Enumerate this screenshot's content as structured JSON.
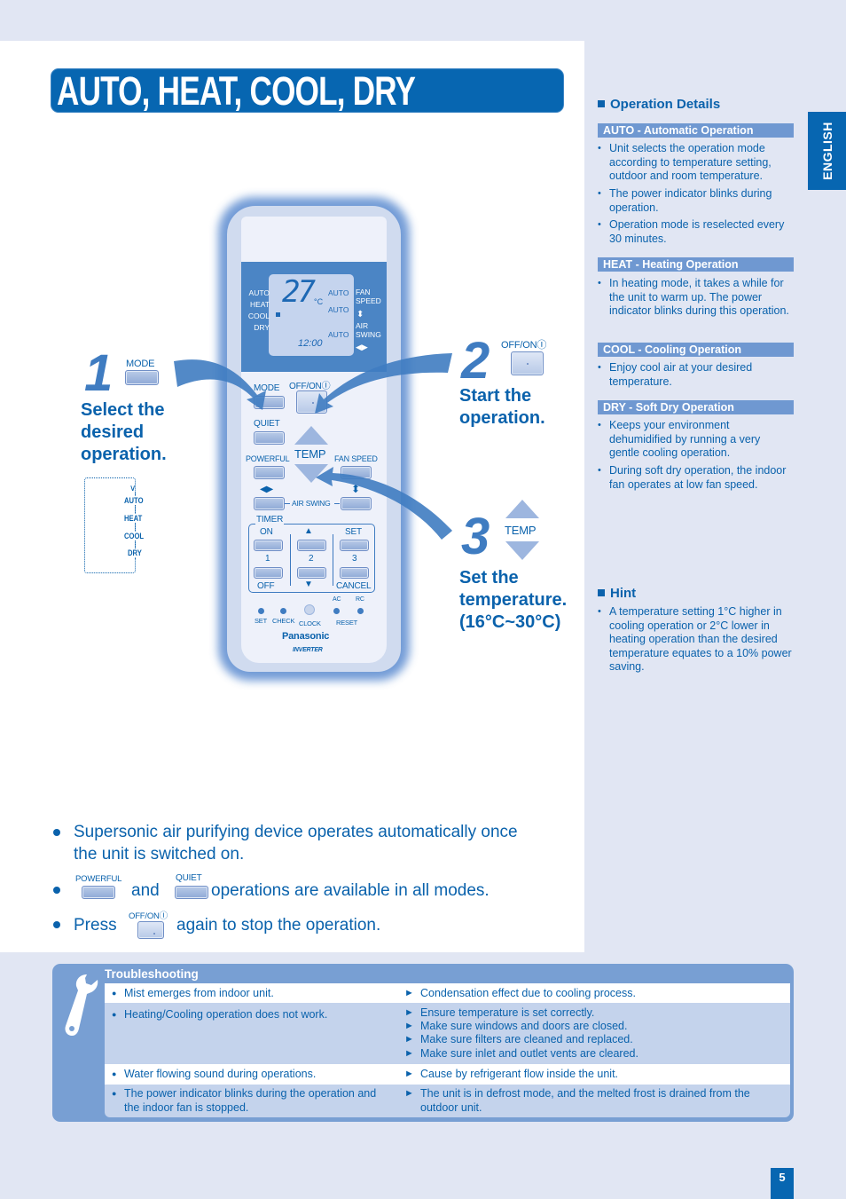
{
  "title": "AUTO, HEAT, COOL, DRY",
  "language_tab": "ENGLISH",
  "page_number": "5",
  "steps": [
    {
      "number": "1",
      "button_label": "MODE",
      "text_lines": [
        "Select the",
        "desired",
        "operation."
      ]
    },
    {
      "number": "2",
      "button_label": "OFF/ONⒾ",
      "text_lines": [
        "Start the",
        "operation."
      ]
    },
    {
      "number": "3",
      "button_label": "TEMP",
      "text_lines": [
        "Set the",
        "temperature.",
        "(16°C~30°C)"
      ]
    }
  ],
  "mode_cycle": [
    "AUTO",
    "HEAT",
    "COOL",
    "DRY"
  ],
  "remote": {
    "display": {
      "modes": [
        "AUTO",
        "HEAT",
        "COOL",
        "DRY"
      ],
      "temperature": "27",
      "unit": "°C",
      "clock": "12:00",
      "auto_labels": [
        "AUTO",
        "AUTO",
        "AUTO"
      ],
      "fan_speed_label": [
        "FAN",
        "SPEED"
      ],
      "air_swing_label": [
        "AIR",
        "SWING"
      ]
    },
    "buttons": {
      "mode": "MODE",
      "off_on": "OFF/ONⒾ",
      "quiet": "QUIET",
      "powerful": "POWERFUL",
      "temp": "TEMP",
      "fan_speed": "FAN SPEED",
      "air_swing": "AIR SWING",
      "timer": "TIMER",
      "on": "ON",
      "off": "OFF",
      "set": "SET",
      "cancel": "CANCEL",
      "num1": "1",
      "num2": "2",
      "num3": "3",
      "set_small": "SET",
      "check": "CHECK",
      "clock": "CLOCK",
      "ac": "AC",
      "rc": "RC",
      "reset": "RESET"
    },
    "brand": "Panasonic",
    "sub_brand": "INVERTER"
  },
  "notes": {
    "line1a": "Supersonic air purifying device operates automatically once",
    "line1b": "the unit is switched on.",
    "powerful_label": "POWERFUL",
    "and": "and",
    "quiet_label": "QUIET",
    "line2_tail": "operations are available in all modes.",
    "press": "Press",
    "offon_label": "OFF/ONⒾ",
    "line3_tail": "again to stop the operation."
  },
  "operation_details": {
    "heading": "Operation Details",
    "sections": [
      {
        "title": "AUTO - Automatic Operation",
        "items": [
          "Unit selects the operation mode according to temperature setting, outdoor and room temperature.",
          "The power indicator blinks during operation.",
          "Operation mode is reselected every 30 minutes."
        ]
      },
      {
        "title": "HEAT - Heating Operation",
        "items": [
          "In heating mode, it takes a while for the unit to warm up. The power indicator blinks during this operation."
        ]
      },
      {
        "title": "COOL - Cooling Operation",
        "items": [
          "Enjoy cool air at your desired temperature."
        ]
      },
      {
        "title": "DRY - Soft Dry Operation",
        "items": [
          "Keeps your environment dehumidified by running a very gentle cooling operation.",
          "During soft dry operation, the indoor fan operates at low fan speed."
        ]
      }
    ]
  },
  "hint": {
    "heading": "Hint",
    "items": [
      "A temperature setting 1°C higher in cooling operation or 2°C lower in heating operation than the desired temperature equates to a 10% power saving."
    ]
  },
  "troubleshooting": {
    "title": "Troubleshooting",
    "rows": [
      {
        "cause": "Mist emerges from indoor unit.",
        "solutions": [
          "Condensation effect due to cooling process."
        ]
      },
      {
        "cause": "Heating/Cooling operation does not work.",
        "solutions": [
          "Ensure temperature is set correctly.",
          "Make sure windows and doors are closed.",
          "Make sure filters are cleaned and replaced.",
          "Make sure inlet and outlet vents are cleared."
        ]
      },
      {
        "cause": "Water flowing sound during operations.",
        "solutions": [
          "Cause by refrigerant flow inside the unit."
        ]
      },
      {
        "cause": "The power indicator blinks during the operation and the indoor fan is stopped.",
        "solutions": [
          "The unit is in defrost mode, and the melted frost is drained from the outdoor unit."
        ]
      }
    ]
  },
  "colors": {
    "brand_blue": "#0766b1",
    "text_blue": "#0a62ac",
    "bar_blue": "#6f98d1",
    "page_bg": "#e1e6f3"
  }
}
